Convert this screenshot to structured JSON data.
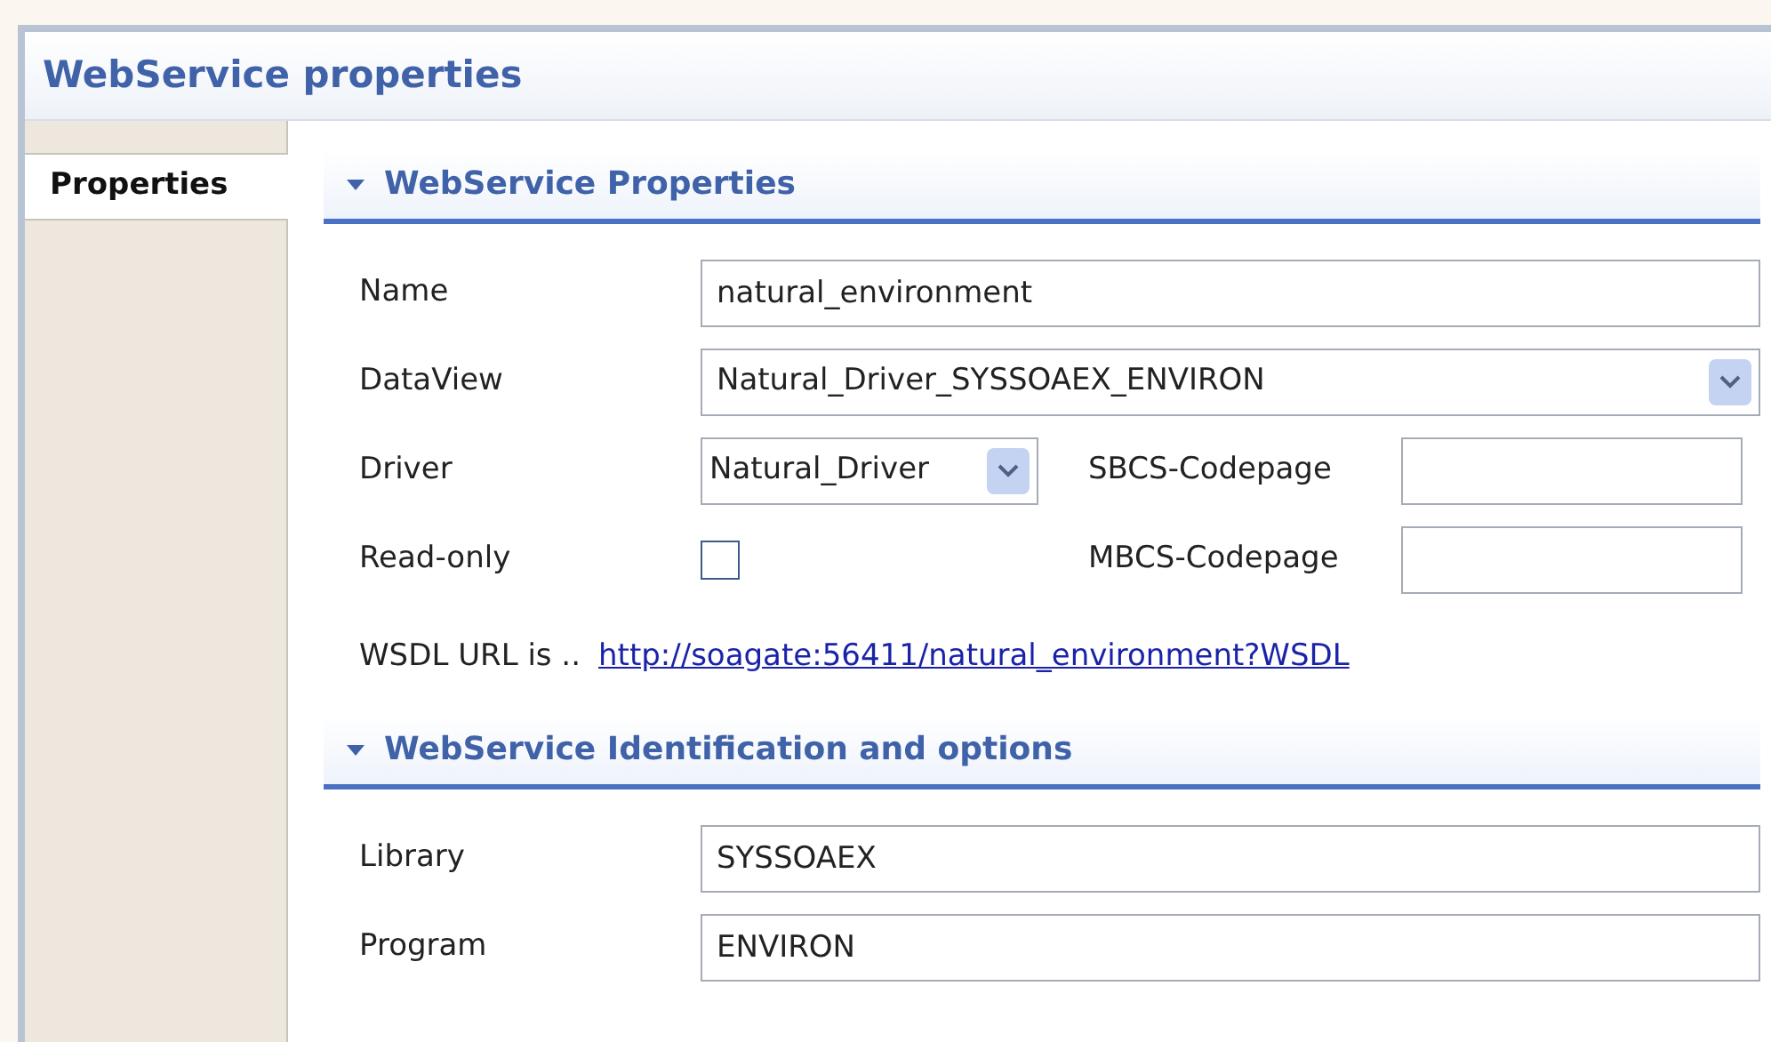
{
  "window": {
    "title": "WebService properties"
  },
  "tabs": [
    {
      "label": "Properties",
      "selected": true
    }
  ],
  "sections": [
    {
      "title": "WebService Properties",
      "expanded": true,
      "rows": [
        {
          "kind": "text",
          "label": "Name",
          "value": "natural_environment"
        },
        {
          "kind": "combo",
          "label": "DataView",
          "value": "Natural_Driver_SYSSOAEX_ENVIRON"
        },
        {
          "kind": "combo_pair",
          "label": "Driver",
          "value": "Natural_Driver",
          "side_label": "SBCS-Codepage"
        },
        {
          "kind": "check_pair",
          "label": "Read-only",
          "checked": false,
          "side_label": "MBCS-Codepage"
        },
        {
          "kind": "link",
          "label": "WSDL URL is ..",
          "link": "http://soagate:56411/natural_environment?WSDL"
        }
      ]
    },
    {
      "title": "WebService Identification and options",
      "expanded": true,
      "rows": [
        {
          "kind": "text",
          "label": "Library",
          "value": "SYSSOAEX"
        },
        {
          "kind": "text",
          "label": "Program",
          "value": "ENVIRON"
        }
      ]
    }
  ]
}
